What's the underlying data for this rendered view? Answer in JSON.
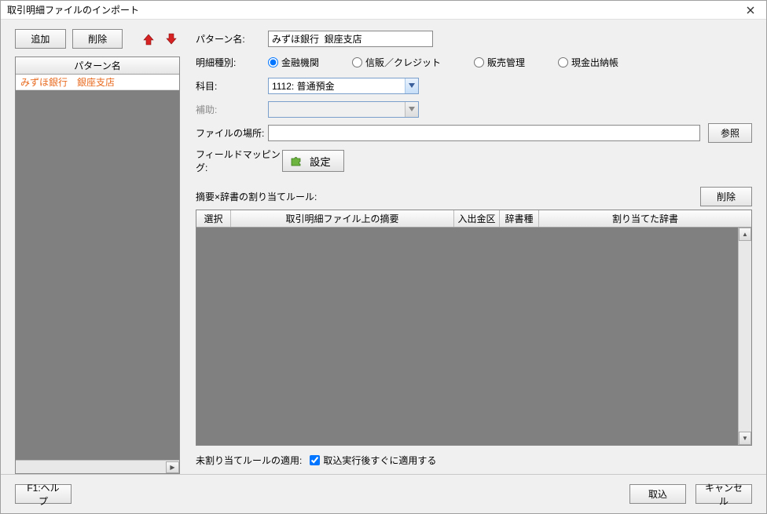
{
  "window": {
    "title": "取引明細ファイルのインポート"
  },
  "left": {
    "add_label": "追加",
    "delete_label": "削除",
    "pattern_header": "パターン名",
    "pattern_item": "みずほ銀行　銀座支店"
  },
  "form": {
    "pattern_name_label": "パターン名:",
    "pattern_name_value": "みずほ銀行  銀座支店",
    "type_label": "明細種別:",
    "type_options": {
      "financial": "金融機関",
      "credit": "信販／クレジット",
      "sales": "販売管理",
      "cashbook": "現金出納帳"
    },
    "account_label": "科目:",
    "account_value": "1112: 普通預金",
    "sub_label": "補助:",
    "sub_value": "",
    "file_label": "ファイルの場所:",
    "file_value": "",
    "browse_label": "参照",
    "mapping_label": "フィールドマッピング:",
    "setting_label": "設定",
    "rules_label": "摘要×辞書の割り当てルール:",
    "rules_delete_label": "削除",
    "table": {
      "col_select": "選択",
      "col_summary": "取引明細ファイル上の摘要",
      "col_io": "入出金区",
      "col_dtype": "辞書種",
      "col_dict": "割り当てた辞書"
    },
    "apply_label": "未割り当てルールの適用:",
    "apply_check_label": "取込実行後すぐに適用する"
  },
  "footer": {
    "help_label": "F1:ヘルプ",
    "import_label": "取込",
    "cancel_label": "キャンセル"
  }
}
